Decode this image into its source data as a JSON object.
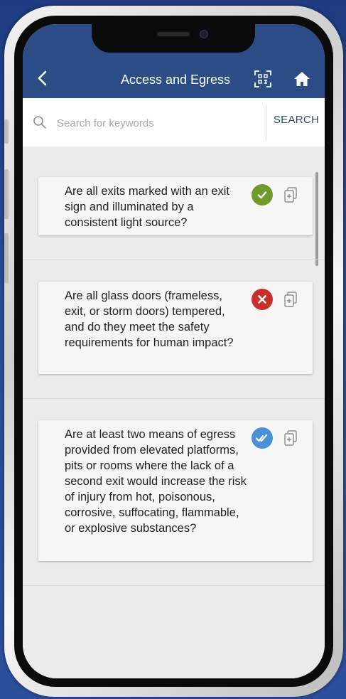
{
  "header": {
    "title": "Access and Egress",
    "background": "#2b4c85",
    "icons": [
      "chevron-left-icon",
      "qr-scan-icon",
      "home-icon"
    ]
  },
  "search": {
    "placeholder": "Search for keywords",
    "value": "",
    "button_label": "SEARCH"
  },
  "items": [
    {
      "text": "Are all exits marked with an exit sign and illuminated by a consistent light source?",
      "status": "passed",
      "status_icon": "check-icon",
      "status_color": "#6e9a2e"
    },
    {
      "text": "Are all glass doors (frameless, exit, or storm doors) tempered, and do they meet the safety requirements for human impact?",
      "status": "failed",
      "status_icon": "cross-icon",
      "status_color": "#c9302c"
    },
    {
      "text": "Are at least two means of egress provided from elevated platforms, pits or rooms where the lack of a second exit would increase the risk of injury from hot, poisonous, corrosive, suffocating, flammable, or explosive substances?",
      "status": "reviewed",
      "status_icon": "double-check-icon",
      "status_color": "#4a90d9"
    }
  ]
}
